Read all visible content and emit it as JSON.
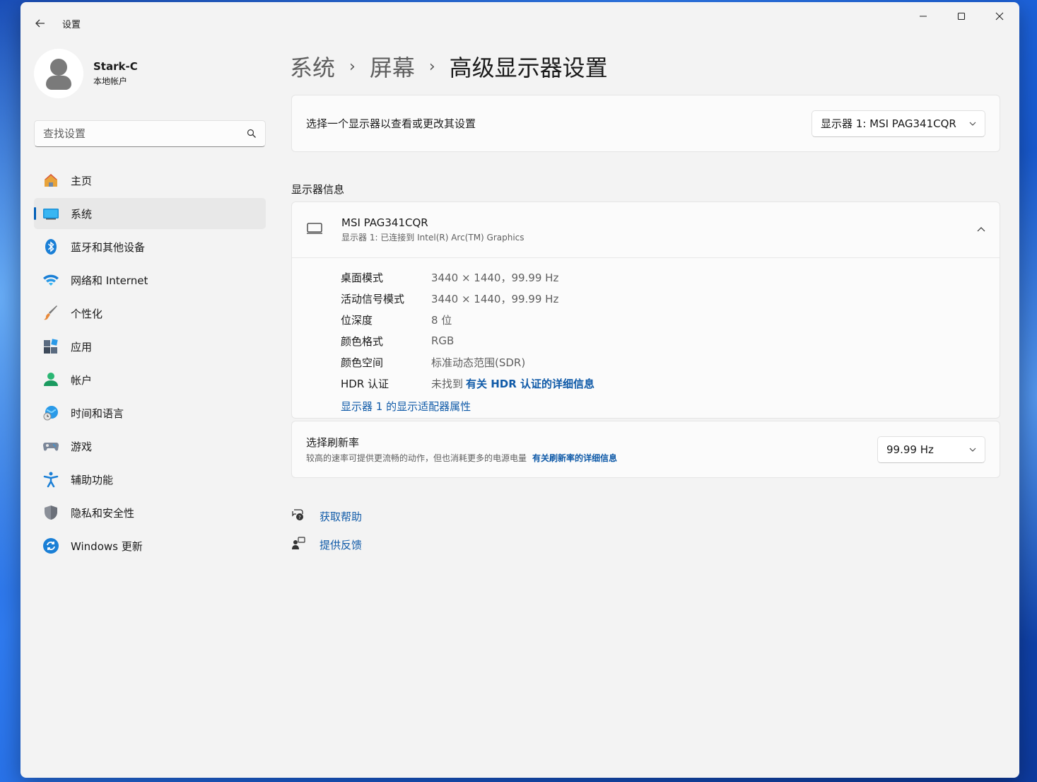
{
  "window": {
    "app_title": "设置"
  },
  "profile": {
    "name": "Stark-C",
    "account_type": "本地帐户"
  },
  "search": {
    "placeholder": "查找设置"
  },
  "sidebar": {
    "items": [
      {
        "label": "主页",
        "icon": "home-icon",
        "active": false
      },
      {
        "label": "系统",
        "icon": "system-display-icon",
        "active": true
      },
      {
        "label": "蓝牙和其他设备",
        "icon": "bluetooth-icon",
        "active": false
      },
      {
        "label": "网络和 Internet",
        "icon": "wifi-icon",
        "active": false
      },
      {
        "label": "个性化",
        "icon": "paintbrush-icon",
        "active": false
      },
      {
        "label": "应用",
        "icon": "apps-icon",
        "active": false
      },
      {
        "label": "帐户",
        "icon": "account-icon",
        "active": false
      },
      {
        "label": "时间和语言",
        "icon": "globe-clock-icon",
        "active": false
      },
      {
        "label": "游戏",
        "icon": "gamepad-icon",
        "active": false
      },
      {
        "label": "辅助功能",
        "icon": "accessibility-icon",
        "active": false
      },
      {
        "label": "隐私和安全性",
        "icon": "shield-icon",
        "active": false
      },
      {
        "label": "Windows 更新",
        "icon": "update-icon",
        "active": false
      }
    ]
  },
  "breadcrumb": {
    "level1": "系统",
    "level2": "屏幕",
    "current": "高级显示器设置"
  },
  "monitor_select": {
    "label": "选择一个显示器以查看或更改其设置",
    "selected": "显示器 1: MSI PAG341CQR"
  },
  "display_info": {
    "section_title": "显示器信息",
    "monitor_name": "MSI PAG341CQR",
    "monitor_sub": "显示器 1: 已连接到 Intel(R) Arc(TM) Graphics",
    "rows": [
      {
        "key": "桌面模式",
        "value": "3440 × 1440，99.99 Hz"
      },
      {
        "key": "活动信号模式",
        "value": "3440 × 1440，99.99 Hz"
      },
      {
        "key": "位深度",
        "value": "8 位"
      },
      {
        "key": "颜色格式",
        "value": "RGB"
      },
      {
        "key": "颜色空间",
        "value": "标准动态范围(SDR)"
      }
    ],
    "hdr": {
      "key": "HDR 认证",
      "value": "未找到",
      "link": "有关 HDR 认证的详细信息"
    },
    "adapter_link": "显示器 1 的显示适配器属性"
  },
  "refresh_rate": {
    "title": "选择刷新率",
    "description": "较高的速率可提供更流畅的动作，但也消耗更多的电源电量",
    "link": "有关刷新率的详细信息",
    "selected": "99.99 Hz"
  },
  "help": {
    "get_help": "获取帮助",
    "feedback": "提供反馈"
  },
  "colors": {
    "accent": "#005fb8",
    "link": "#0f5aa8"
  }
}
